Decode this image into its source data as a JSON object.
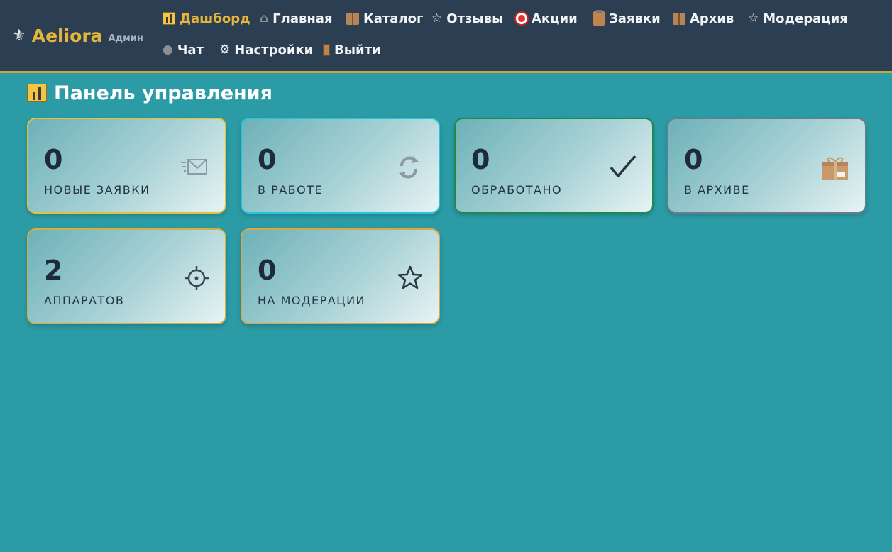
{
  "header": {
    "brand_name": "Aeliora",
    "brand_role": "Админ",
    "nav": [
      {
        "label": "Дашборд",
        "icon": "bar-chart-icon",
        "active": true
      },
      {
        "label": "Главная",
        "icon": "home-icon"
      },
      {
        "label": "Каталог",
        "icon": "gift-icon"
      },
      {
        "label": "Отзывы",
        "icon": "star-icon"
      },
      {
        "label": "Акции",
        "icon": "target-icon"
      },
      {
        "label": "Заявки",
        "icon": "clipboard-icon"
      },
      {
        "label": "Архив",
        "icon": "gift-icon"
      },
      {
        "label": "Модерация",
        "icon": "star-icon"
      },
      {
        "label": "Чат",
        "icon": "chat-bubble-icon"
      },
      {
        "label": "Настройки",
        "icon": "gear-icon"
      },
      {
        "label": "Выйти",
        "icon": "door-icon"
      }
    ]
  },
  "page": {
    "title": "Панель управления"
  },
  "stats": [
    {
      "value": "0",
      "label": "НОВЫЕ ЗАЯВКИ",
      "icon": "envelope-icon",
      "border": "#e3c23b"
    },
    {
      "value": "0",
      "label": "В РАБОТЕ",
      "icon": "refresh-icon",
      "border": "#22c6dd"
    },
    {
      "value": "0",
      "label": "ОБРАБОТАНО",
      "icon": "checkmark-icon",
      "border": "#1f8a4d"
    },
    {
      "value": "0",
      "label": "В АРХИВЕ",
      "icon": "package-icon",
      "border": "#6c7b8a"
    },
    {
      "value": "2",
      "label": "АППАРАТОВ",
      "icon": "sun-icon",
      "border": "#d4b044"
    },
    {
      "value": "0",
      "label": "НА МОДЕРАЦИИ",
      "icon": "star-outline-icon",
      "border": "#d8a848"
    }
  ],
  "colors": {
    "background": "#2b9ba5",
    "header": "#2c3e52",
    "accent": "#e3b53c"
  }
}
